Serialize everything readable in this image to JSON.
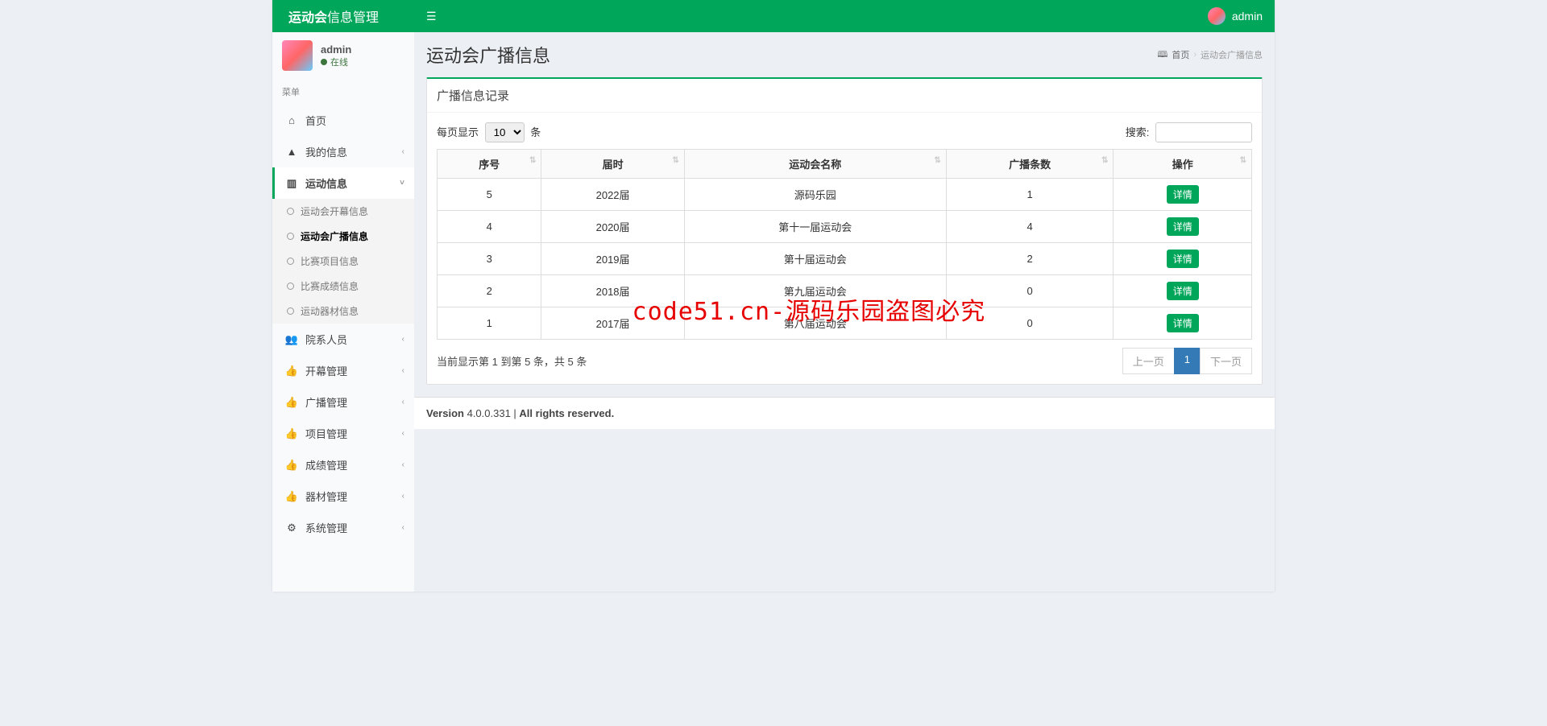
{
  "app": {
    "logo_bold": "运动会",
    "logo_light": "信息管理"
  },
  "header": {
    "username": "admin"
  },
  "sidebar": {
    "user": {
      "name": "admin",
      "status": "在线"
    },
    "menu_header": "菜单",
    "items": [
      {
        "icon": "⌂",
        "label": "首页"
      },
      {
        "icon": "▲",
        "label": "我的信息",
        "chev": "‹"
      },
      {
        "icon": "▥",
        "label": "运动信息",
        "chev": "˅",
        "active": true,
        "children": [
          {
            "label": "运动会开幕信息"
          },
          {
            "label": "运动会广播信息",
            "active": true
          },
          {
            "label": "比赛项目信息"
          },
          {
            "label": "比赛成绩信息"
          },
          {
            "label": "运动器材信息"
          }
        ]
      },
      {
        "icon": "👥",
        "label": "院系人员",
        "chev": "‹"
      },
      {
        "icon": "👍",
        "label": "开幕管理",
        "chev": "‹"
      },
      {
        "icon": "👍",
        "label": "广播管理",
        "chev": "‹"
      },
      {
        "icon": "👍",
        "label": "项目管理",
        "chev": "‹"
      },
      {
        "icon": "👍",
        "label": "成绩管理",
        "chev": "‹"
      },
      {
        "icon": "👍",
        "label": "器材管理",
        "chev": "‹"
      },
      {
        "icon": "⚙",
        "label": "系统管理",
        "chev": "‹"
      }
    ]
  },
  "page": {
    "title": "运动会广播信息",
    "breadcrumb": {
      "home_icon": "⚙",
      "home": "首页",
      "current": "运动会广播信息"
    }
  },
  "box": {
    "title": "广播信息记录",
    "length_prefix": "每页显示",
    "length_suffix": "条",
    "length_value": "10",
    "search_label": "搜索:",
    "columns": [
      "序号",
      "届时",
      "运动会名称",
      "广播条数",
      "操作"
    ],
    "rows": [
      {
        "seq": "5",
        "year": "2022届",
        "name": "源码乐园",
        "count": "1",
        "action": "详情"
      },
      {
        "seq": "4",
        "year": "2020届",
        "name": "第十一届运动会",
        "count": "4",
        "action": "详情"
      },
      {
        "seq": "3",
        "year": "2019届",
        "name": "第十届运动会",
        "count": "2",
        "action": "详情"
      },
      {
        "seq": "2",
        "year": "2018届",
        "name": "第九届运动会",
        "count": "0",
        "action": "详情"
      },
      {
        "seq": "1",
        "year": "2017届",
        "name": "第八届运动会",
        "count": "0",
        "action": "详情"
      }
    ],
    "info": "当前显示第 1 到第 5 条，共 5 条",
    "pagination": {
      "prev": "上一页",
      "pages": [
        "1"
      ],
      "next": "下一页"
    }
  },
  "watermark": "code51.cn-源码乐园盗图必究",
  "footer": {
    "version_label": "Version",
    "version": "4.0.0.331",
    "rights": "All rights reserved."
  }
}
